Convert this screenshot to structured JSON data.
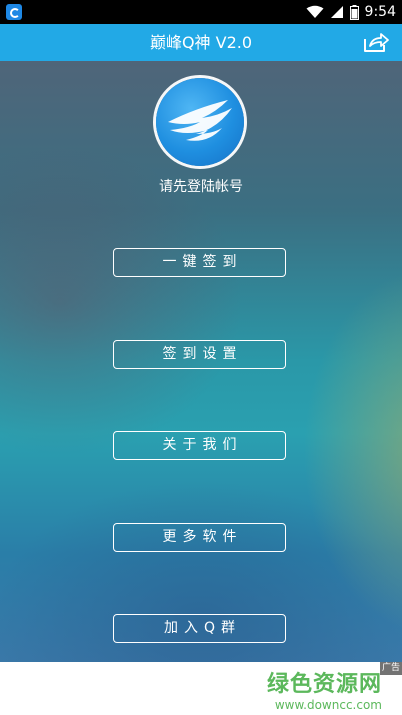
{
  "status_bar": {
    "time": "9:54",
    "icons": [
      "app-notification-icon",
      "wifi-icon",
      "signal-icon",
      "battery-icon"
    ]
  },
  "title_bar": {
    "title": "巅峰Q神 V2.0",
    "share_icon": "share-icon"
  },
  "profile": {
    "logo_icon": "bird-logo-icon",
    "login_prompt": "请先登陆帐号"
  },
  "menu": {
    "items": [
      {
        "label": "一键签到"
      },
      {
        "label": "签到设置"
      },
      {
        "label": "关于我们"
      },
      {
        "label": "更多软件"
      },
      {
        "label": "加入Q群"
      }
    ]
  },
  "ad": {
    "tag": "广告",
    "watermark_title": "绿色资源网",
    "watermark_url": "www.downcc.com"
  },
  "colors": {
    "title_bar": "#22a9e6",
    "status_bar": "#000000",
    "watermark": "#5cb85c"
  }
}
